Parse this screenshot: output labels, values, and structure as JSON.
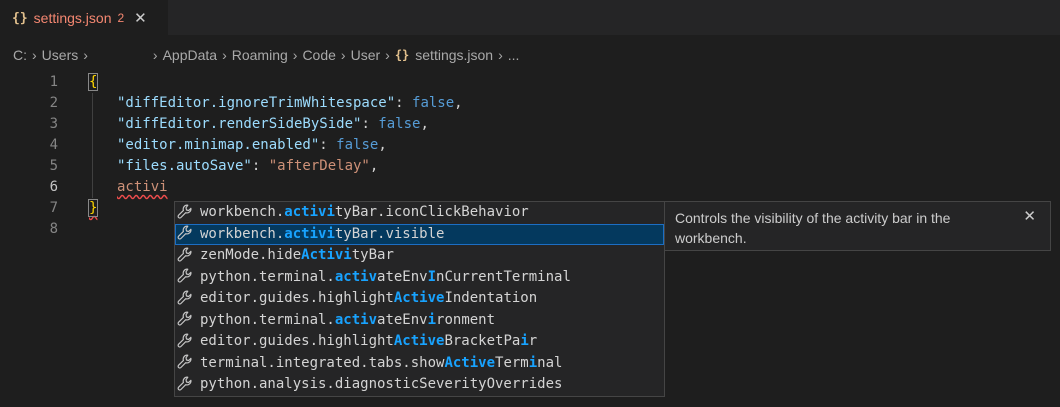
{
  "tab": {
    "icon": "{}",
    "title": "settings.json",
    "problem_count": "2",
    "close": "✕"
  },
  "breadcrumb": {
    "items": [
      "C:",
      "Users",
      "AppData",
      "Roaming",
      "Code",
      "User",
      "settings.json",
      "..."
    ],
    "file_icon": "{}"
  },
  "editor": {
    "line_numbers": [
      "1",
      "2",
      "3",
      "4",
      "5",
      "6",
      "7",
      "8"
    ],
    "active_line": "6",
    "lines": {
      "l1": "{",
      "l2_key": "\"diffEditor.ignoreTrimWhitespace\"",
      "l2_val": "false",
      "l3_key": "\"diffEditor.renderSideBySide\"",
      "l3_val": "false",
      "l4_key": "\"editor.minimap.enabled\"",
      "l4_val": "false",
      "l5_key": "\"files.autoSave\"",
      "l5_val": "\"afterDelay\"",
      "l6": "activi",
      "l7": "}"
    }
  },
  "suggest": {
    "icon": "wrench-icon",
    "items": [
      {
        "segments": [
          "workbench.",
          "activi",
          "tyBar.iconClickBehavior"
        ]
      },
      {
        "segments": [
          "workbench.",
          "activi",
          "tyBar.visible"
        ]
      },
      {
        "segments": [
          "zenMode.hide",
          "Activi",
          "tyBar"
        ]
      },
      {
        "segments": [
          "python.terminal.",
          "activ",
          "ateEnv",
          "I",
          "nCurrentTerminal"
        ]
      },
      {
        "segments": [
          "editor.guides.highlight",
          "Active",
          "Indentation"
        ]
      },
      {
        "segments": [
          "python.terminal.",
          "activ",
          "ateEnv",
          "i",
          "ronment"
        ]
      },
      {
        "segments": [
          "editor.guides.highlight",
          "Active",
          "BracketPa",
          "i",
          "r"
        ]
      },
      {
        "segments": [
          "terminal.integrated.tabs.show",
          "Active",
          "Term",
          "i",
          "nal"
        ]
      },
      {
        "segments": [
          "python.analysis.diagnosticSeverityOverrides"
        ]
      }
    ],
    "selected_index": 1,
    "details": "Controls the visibility of the activity bar in the workbench.",
    "details_close": "✕"
  },
  "colors": {
    "selection": "#04395e",
    "match": "#18a3ff",
    "error": "#f48771"
  }
}
